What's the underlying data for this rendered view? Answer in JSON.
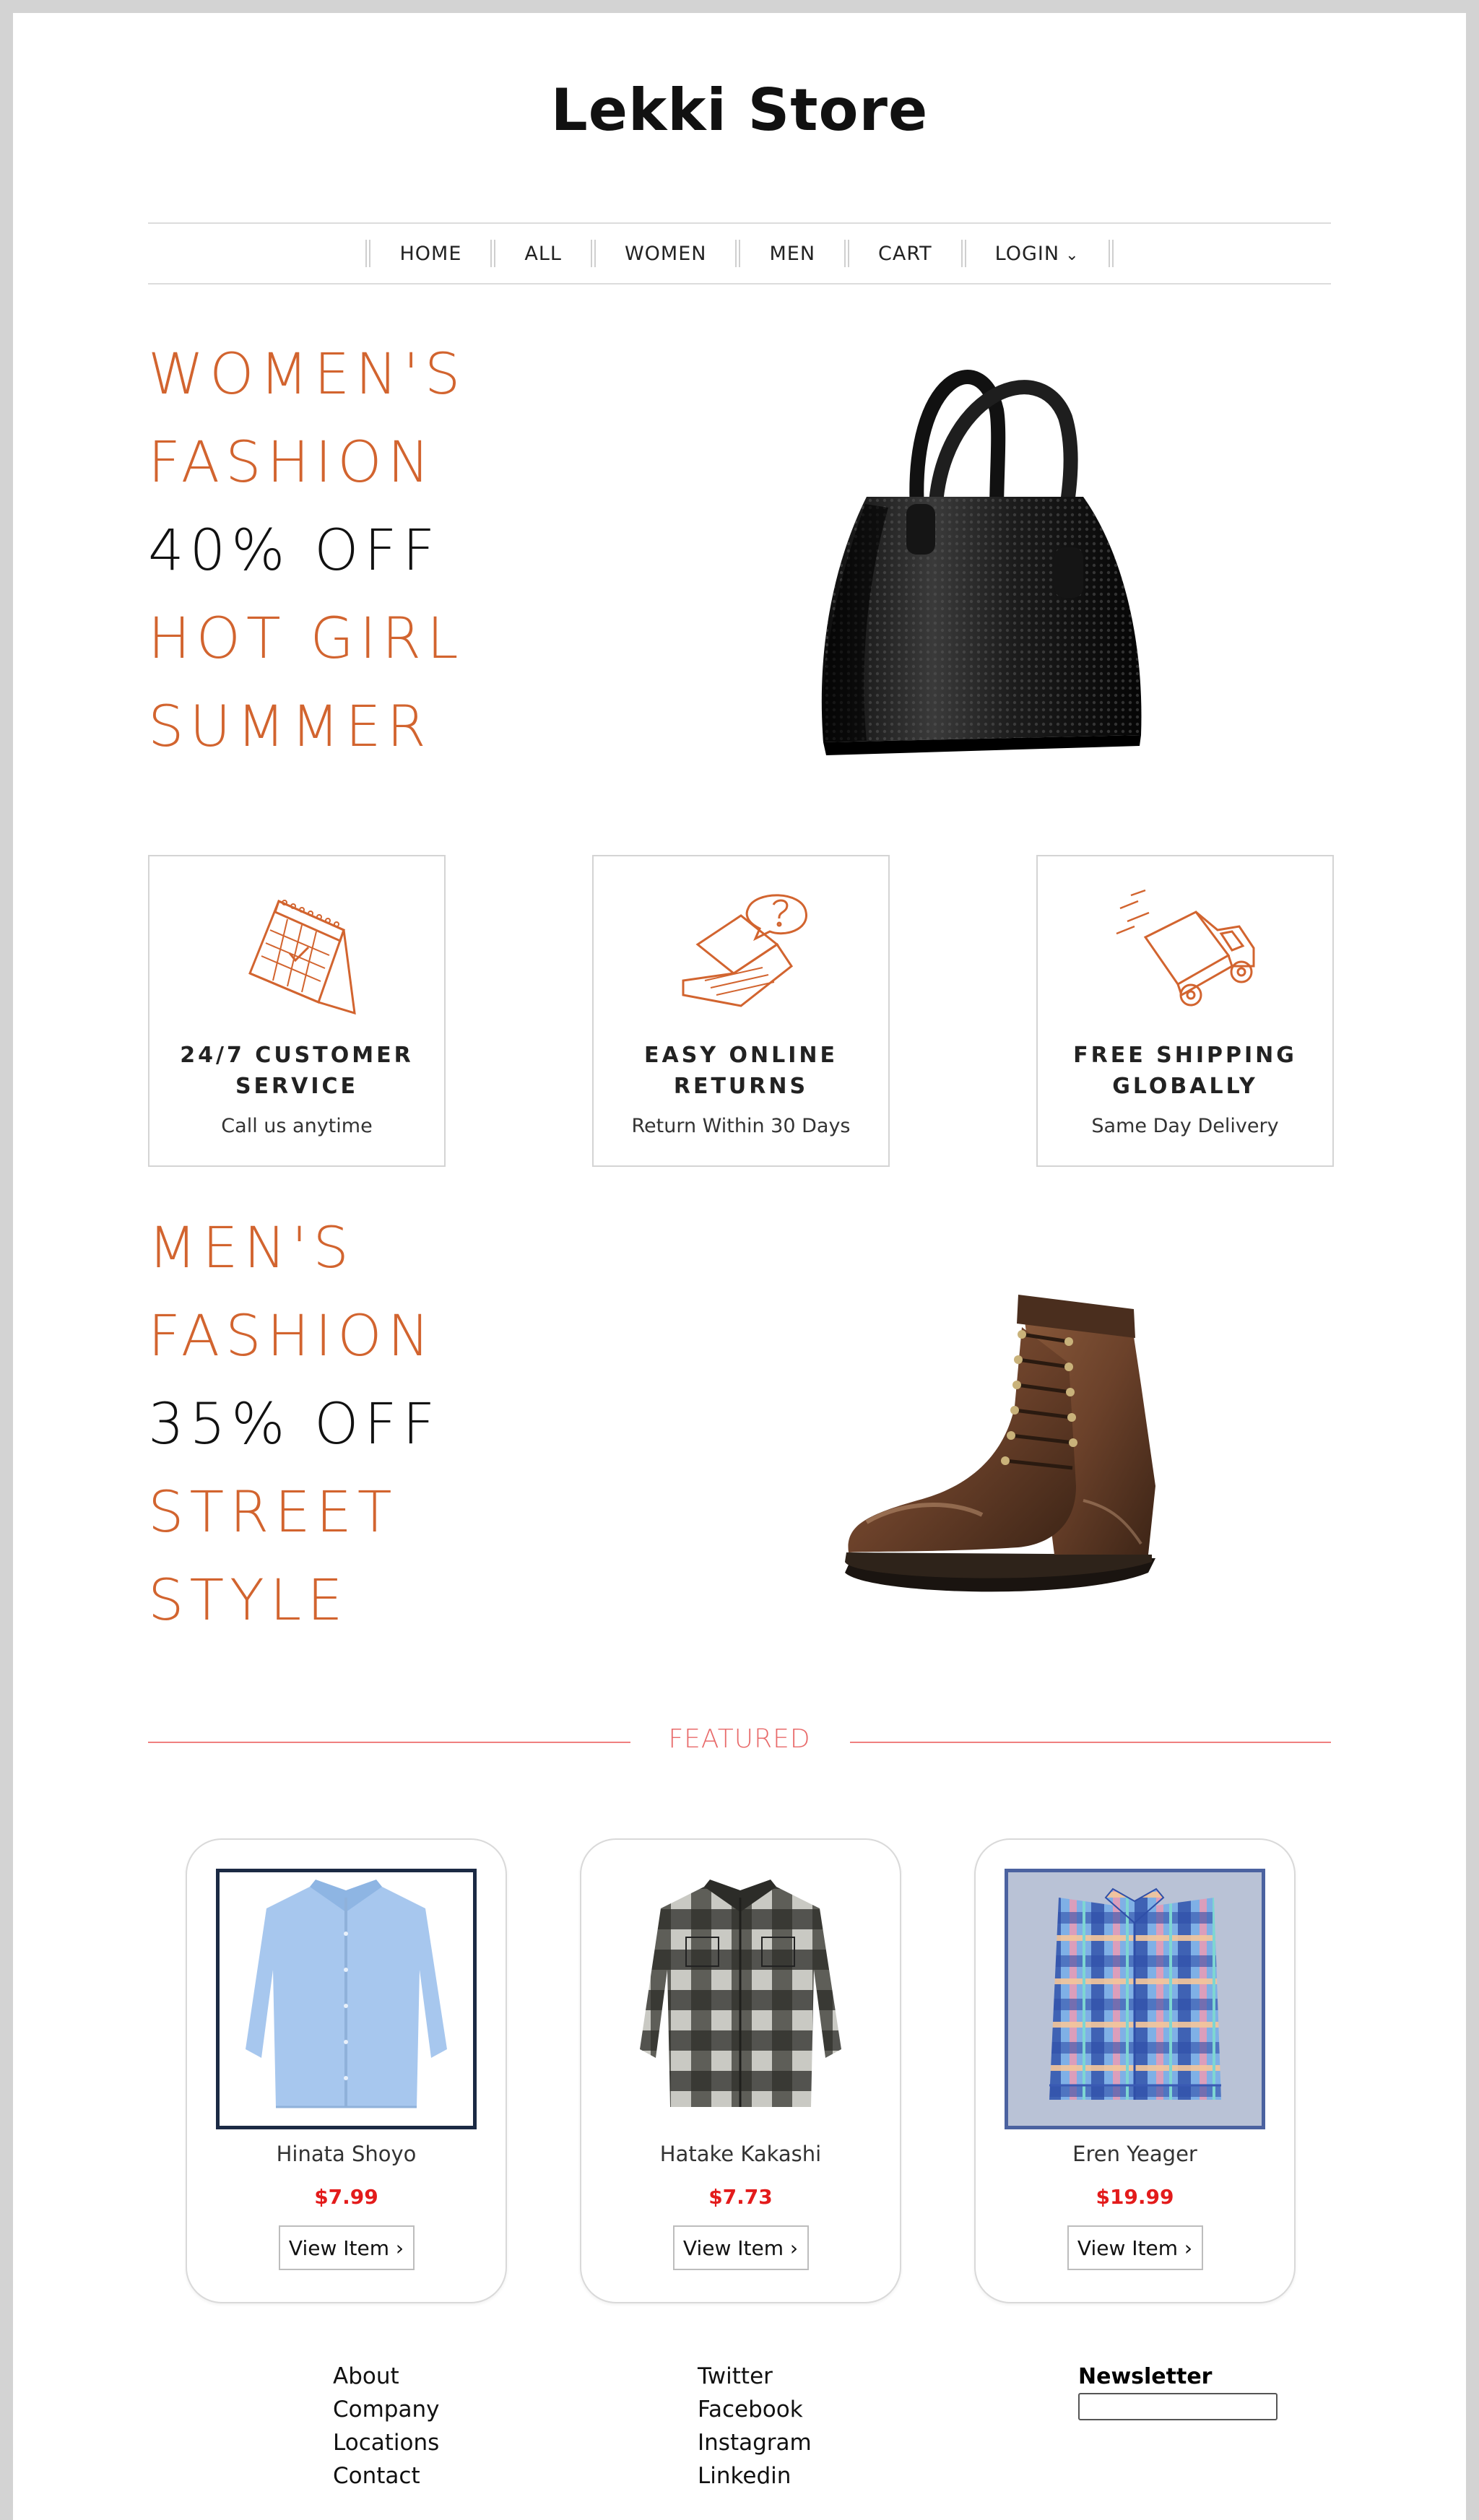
{
  "header": {
    "title": "Lekki Store"
  },
  "nav": {
    "items": [
      "HOME",
      "ALL",
      "WOMEN",
      "MEN",
      "CART",
      "LOGIN"
    ],
    "login_chevron": "chevron-down-icon"
  },
  "hero_women": {
    "lines": [
      "WOMEN'S",
      "FASHION",
      "40% OFF",
      "HOT GIRL",
      "SUMMER"
    ],
    "image": "black-handbag"
  },
  "features": [
    {
      "icon": "calendar-icon",
      "title_1": "24/7 CUSTOMER",
      "title_2": "SERVICE",
      "subtitle": "Call us anytime"
    },
    {
      "icon": "laptop-chat-icon",
      "title_1": "EASY ONLINE",
      "title_2": "RETURNS",
      "subtitle": "Return Within 30 Days"
    },
    {
      "icon": "delivery-truck-icon",
      "title_1": "FREE SHIPPING",
      "title_2": "GLOBALLY",
      "subtitle": "Same Day Delivery"
    }
  ],
  "hero_men": {
    "lines": [
      "MEN'S",
      "FASHION",
      "35% OFF",
      "STREET",
      "STYLE"
    ],
    "image": "brown-leather-boot"
  },
  "featured": {
    "label": "FEATURED",
    "products": [
      {
        "name": "Hinata Shoyo",
        "price": "$7.99",
        "button": "View Item ›",
        "image": "light-blue-shirt"
      },
      {
        "name": "Hatake Kakashi",
        "price": "$7.73",
        "button": "View Item ›",
        "image": "plaid-flannel-shirt"
      },
      {
        "name": "Eren Yeager",
        "price": "$19.99",
        "button": "View Item ›",
        "image": "multicolor-plaid-shirt"
      }
    ]
  },
  "footer": {
    "col1": [
      "About",
      "Company",
      "Locations",
      "Contact"
    ],
    "col2": [
      "Twitter",
      "Facebook",
      "Instagram",
      "Linkedin"
    ],
    "newsletter_label": "Newsletter"
  },
  "colors": {
    "accent": "#d2642f",
    "featured": "#e86a6a",
    "price": "#e31b1b"
  }
}
